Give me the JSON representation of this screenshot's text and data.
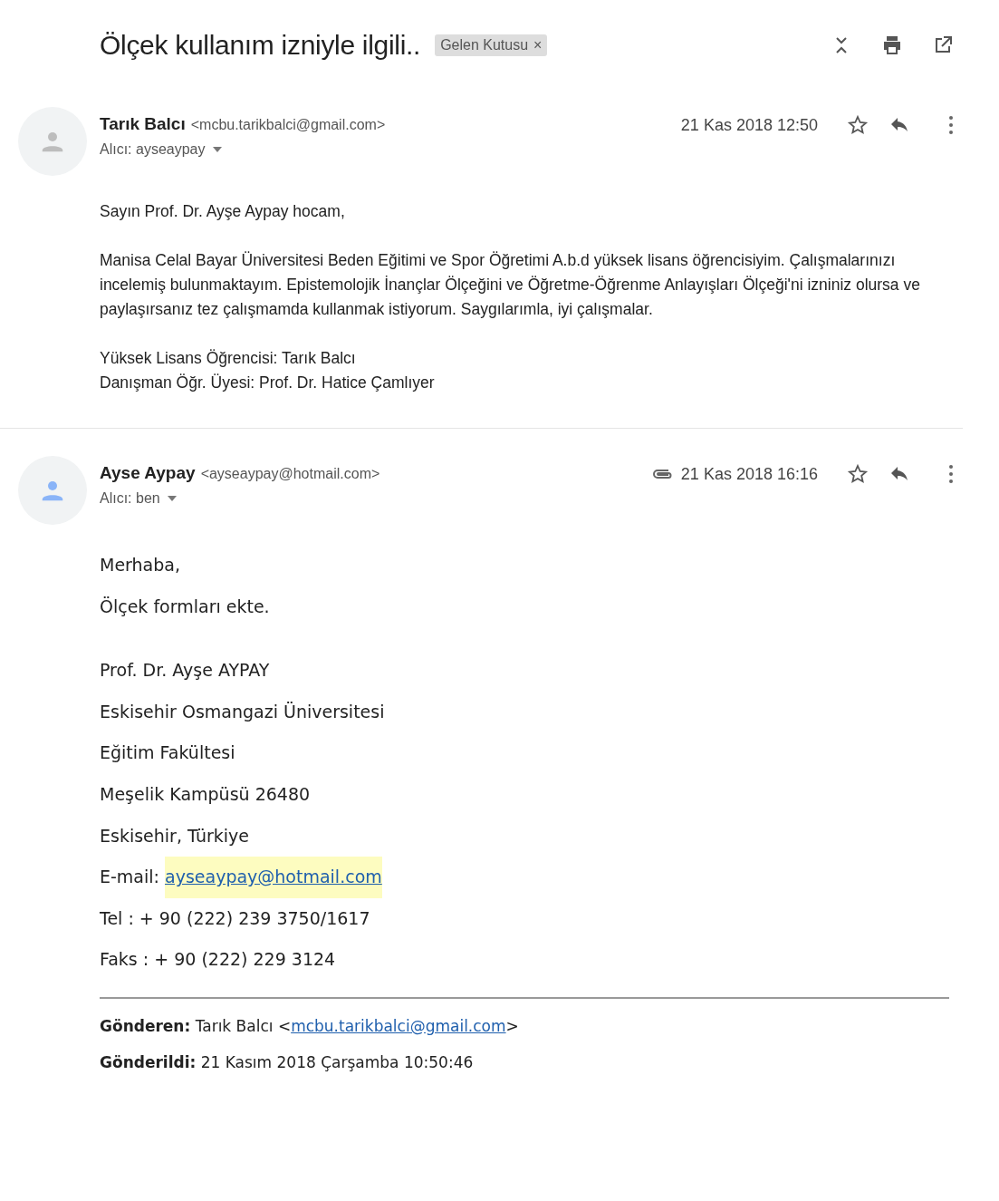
{
  "subject": "Ölçek kullanım izniyle ilgili..",
  "label": {
    "text": "Gelen Kutusu",
    "close": "×"
  },
  "messages": [
    {
      "sender_name": "Tarık Balcı",
      "sender_email": "<mcbu.tarikbalci@gmail.com>",
      "recipient": "Alıcı: ayseaypay",
      "date": "21 Kas 2018 12:50",
      "has_attachment": false,
      "color": "#bdbdbd",
      "kind": "plain",
      "body": [
        {
          "kind": "text",
          "text": "Sayın Prof. Dr. Ayşe Aypay hocam,"
        },
        {
          "kind": "gap"
        },
        {
          "kind": "text",
          "text": "Manisa Celal Bayar Üniversitesi Beden Eğitimi ve Spor Öğretimi A.b.d yüksek lisans öğrencisiyim. Çalışmalarınızı incelemiş bulunmaktayım. Epistemolojik İnançlar Ölçeğini ve Öğretme-Öğrenme Anlayışları Ölçeği'ni izniniz olursa ve paylaşırsanız tez çalışmamda kullanmak istiyorum. Saygılarımla, iyi çalışmalar."
        },
        {
          "kind": "gap"
        },
        {
          "kind": "text",
          "text": "Yüksek Lisans Öğrencisi: Tarık Balcı"
        },
        {
          "kind": "text",
          "text": "Danışman Öğr. Üyesi: Prof. Dr. Hatice Çamlıyer"
        }
      ]
    },
    {
      "sender_name": "Ayse Aypay",
      "sender_email": "<ayseaypay@hotmail.com>",
      "recipient": "Alıcı: ben",
      "date": "21 Kas 2018 16:16",
      "has_attachment": true,
      "color": "#8ab4f8",
      "kind": "office",
      "body": [
        {
          "kind": "text",
          "text": "Merhaba,"
        },
        {
          "kind": "text",
          "text": "Ölçek formları ekte."
        },
        {
          "kind": "gap"
        },
        {
          "kind": "text",
          "text": "Prof. Dr.  Ayşe AYPAY"
        },
        {
          "kind": "text",
          "text": "Eskisehir Osmangazi Üniversitesi"
        },
        {
          "kind": "text",
          "text": "Eğitim Fakültesi"
        },
        {
          "kind": "text",
          "text": "Meşelik Kampüsü 26480"
        },
        {
          "kind": "text",
          "text": "Eskisehir, Türkiye"
        },
        {
          "kind": "link",
          "prefix": "E-mail: ",
          "link": "ayseaypay@hotmail.com",
          "highlighted": true
        },
        {
          "kind": "text",
          "text": "Tel : + 90 (222) 239 3750/1617"
        },
        {
          "kind": "text",
          "text": "Faks : + 90 (222) 229 3124"
        },
        {
          "kind": "rule"
        },
        {
          "kind": "header",
          "label": "Gönderen:",
          "prefix": " Tarık Balcı <",
          "link": "mcbu.tarikbalci@gmail.com",
          "suffix": ">"
        },
        {
          "kind": "header",
          "label": "Gönderildi:",
          "prefix": " 21 Kasım 2018 Çarşamba 10:50:46"
        }
      ]
    }
  ]
}
